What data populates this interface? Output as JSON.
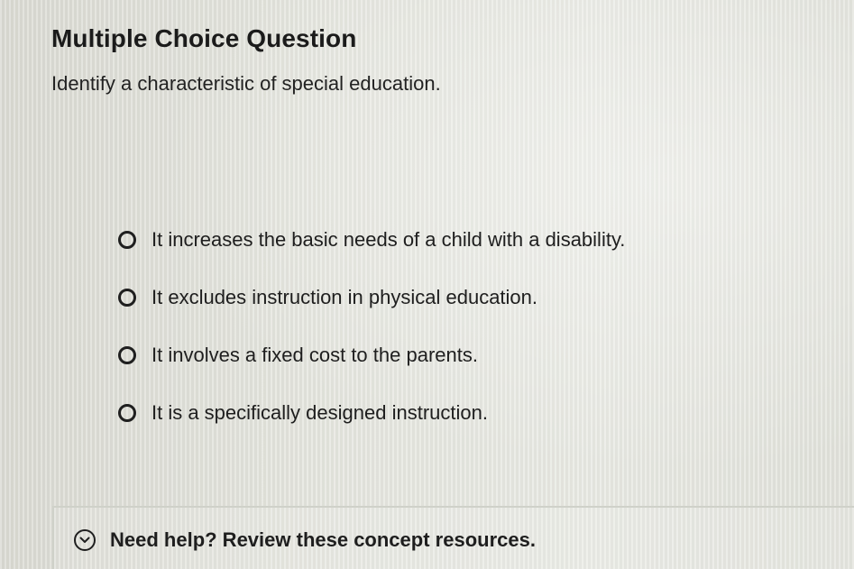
{
  "header": {
    "title": "Multiple Choice Question"
  },
  "question": {
    "prompt": "Identify a characteristic of special education."
  },
  "options": [
    {
      "label": "It increases the basic needs of a child with a disability.",
      "selected": false
    },
    {
      "label": "It excludes instruction in physical education.",
      "selected": false
    },
    {
      "label": "It involves a fixed cost to the parents.",
      "selected": false
    },
    {
      "label": "It is a specifically designed instruction.",
      "selected": false
    }
  ],
  "help": {
    "label": "Need help? Review these concept resources.",
    "icon": "chevron-down-icon"
  }
}
